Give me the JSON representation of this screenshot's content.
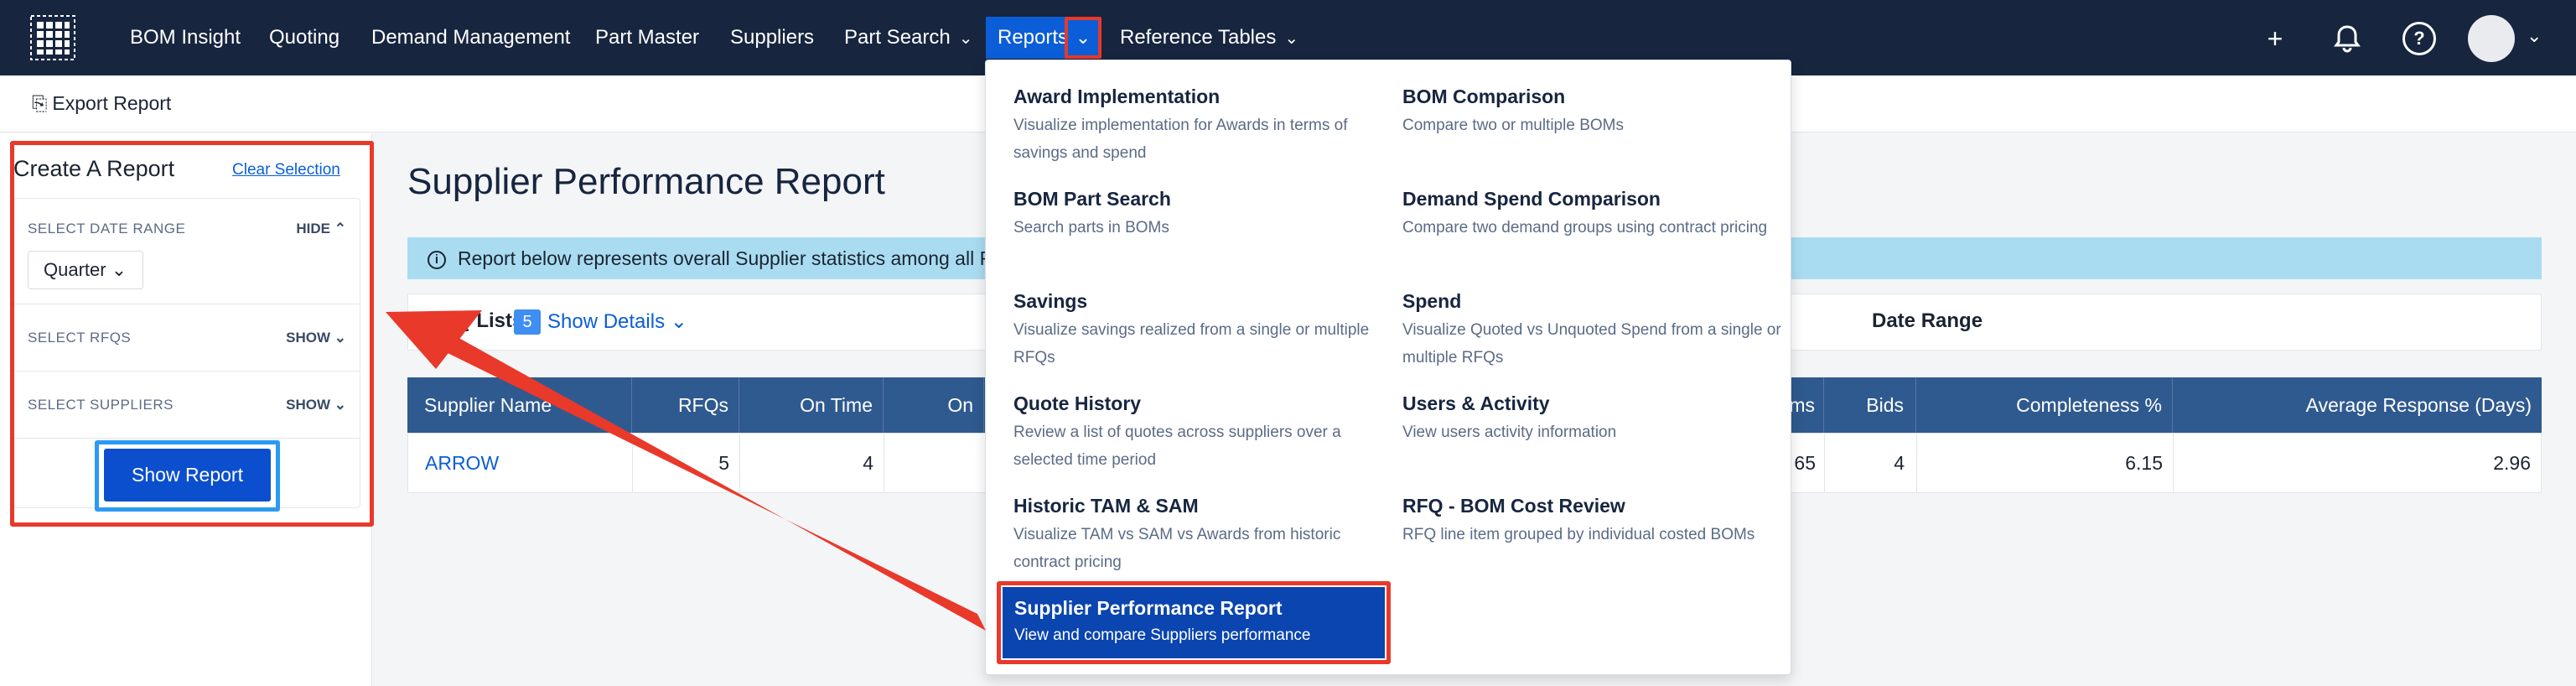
{
  "nav": {
    "items": [
      "BOM Insight",
      "Quoting",
      "Demand Management",
      "Part Master",
      "Suppliers",
      "Part Search",
      "Reports",
      "Reference Tables"
    ]
  },
  "toolbar": {
    "export_label": "Export Report"
  },
  "create_report": {
    "title": "Create A Report",
    "clear_label": "Clear Selection",
    "date_range_label": "SELECT DATE RANGE",
    "date_range_toggle": "HIDE",
    "date_range_value": "Quarter",
    "rfqs_label": "SELECT RFQS",
    "rfqs_toggle": "SHOW",
    "suppliers_label": "SELECT SUPPLIERS",
    "suppliers_toggle": "SHOW",
    "show_report_label": "Show Report"
  },
  "main": {
    "title": "Supplier Performance Report",
    "banner_text": "Report below represents overall Supplier statistics among all R",
    "rfq_lists_label": "RFQ Lists",
    "rfq_count": "5",
    "show_details_label": "Show Details",
    "date_range_label": "Date Range"
  },
  "table": {
    "headers": [
      "Supplier Name",
      "RFQs",
      "On Time",
      "On",
      "ems",
      "Bids",
      "Completeness %",
      "Average Response (Days)"
    ],
    "row": [
      "ARROW",
      "5",
      "4",
      "65",
      "4",
      "6.15",
      "2.96"
    ]
  },
  "menu": {
    "items": [
      {
        "title": "Award Implementation",
        "desc": "Visualize implementation for Awards in terms of savings and spend"
      },
      {
        "title": "BOM Comparison",
        "desc": "Compare two or multiple BOMs"
      },
      {
        "title": "BOM Part Search",
        "desc": "Search parts in BOMs"
      },
      {
        "title": "Demand Spend Comparison",
        "desc": "Compare two demand groups using contract pricing"
      },
      {
        "title": "Savings",
        "desc": "Visualize savings realized from a single or multiple RFQs"
      },
      {
        "title": "Spend",
        "desc": "Visualize Quoted vs Unquoted Spend from a single or multiple RFQs"
      },
      {
        "title": "Quote History",
        "desc": "Review a list of quotes across suppliers over a selected time period"
      },
      {
        "title": "Users & Activity",
        "desc": "View users activity information"
      },
      {
        "title": "Historic TAM & SAM",
        "desc": "Visualize TAM vs SAM vs Awards from historic contract pricing"
      },
      {
        "title": "RFQ - BOM Cost Review",
        "desc": "RFQ line item grouped by individual costed BOMs"
      },
      {
        "title": "Supplier Performance Report",
        "desc": "View and compare Suppliers performance"
      }
    ]
  },
  "colors": {
    "nav_bg": "#17253f",
    "accent": "#0b5ed7",
    "highlight_red": "#e8392b",
    "highlight_blue": "#2b9af3",
    "table_header": "#2f5a8f",
    "banner": "#a9dcf1"
  },
  "icons": [
    "grid-logo-icon",
    "chevron-down-icon",
    "plus-icon",
    "bell-icon",
    "help-icon",
    "avatar",
    "export-icon",
    "info-icon",
    "chevron-up-icon"
  ]
}
